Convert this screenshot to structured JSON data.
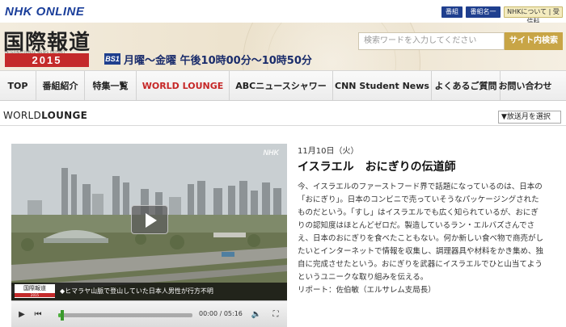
{
  "header": {
    "logo": "NHK ONLINE",
    "links": [
      "番組表",
      "番組名一覧",
      "NHKについて | 受信料"
    ]
  },
  "banner": {
    "title": "国際報道",
    "subtitle": "INTERNATIONAL NEWS REPORT",
    "year": "2015",
    "channel": "BS1",
    "schedule": "月曜～金曜 午後10時00分～10時50分"
  },
  "search": {
    "placeholder": "検索ワードを入力してください",
    "button": "サイト内検索"
  },
  "nav": {
    "items": [
      "TOP",
      "番組紹介",
      "特集一覧",
      "WORLD LOUNGE",
      "ABCニュースシャワー",
      "CNN Student News",
      "よくあるご質問",
      "お問い合わせ"
    ],
    "active": "WORLD LOUNGE"
  },
  "section": {
    "title_prefix": "WORLD",
    "title_main": "LOUNGE",
    "select_value": "▼放送月を選択"
  },
  "video": {
    "watermark": "NHK",
    "caption_logo": "国際報道",
    "caption_year": "2015",
    "caption_text": "◆ヒマラヤ山脈で登山していた日本人男性が行方不明",
    "time": "00:00 / 05:16",
    "progress": 0.02
  },
  "article": {
    "date": "11月10日（火）",
    "title": "イスラエル　おにぎりの伝道師",
    "lines": [
      "今、イスラエルのファーストフード界で話題になっているのは、日本の",
      "「おにぎり」。日本のコンビニで売っていそうなパッケージングされた",
      "ものだという。「すし」はイスラエルでも広く知られているが、おにぎ",
      "りの認知度はほとんどゼロだ。製造しているラン・エルバズさんでさ",
      "え、日本のおにぎりを食べたこともない。何か新しい食べ物で商売がし",
      "たいとインターネットで情報を収集し、調理器具や材料をかき集め、独",
      "自に完成させたという。おにぎりを武器にイスラエルでひと山当てよう",
      "というユニークな取り組みを伝える。",
      "リポート：佐伯敏（エルサレム支局長）"
    ]
  },
  "colors": {
    "brand_blue": "#1f3f8e",
    "accent_red": "#c62727",
    "search_gold": "#c8a546"
  }
}
